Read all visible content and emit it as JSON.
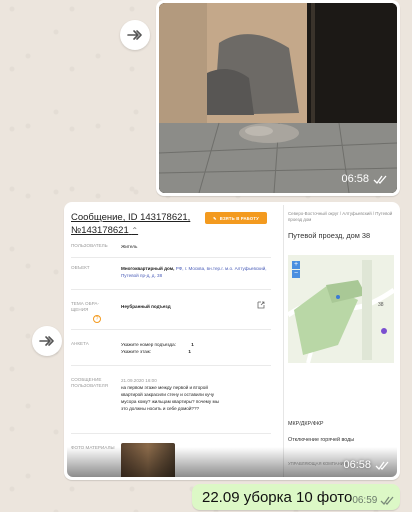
{
  "photo_message": {
    "time": "06:58"
  },
  "screenshot_message": {
    "time": "06:58",
    "title": "Сообщение, ID 143178621, №143178621",
    "take_button": "ВЗЯТЬ В РАБОТУ",
    "fields": [
      {
        "label": "ПОЛЬЗОВАТЕЛЬ",
        "value": "Житель"
      },
      {
        "label": "ОБЪЕКТ",
        "value_bold": "Многоквартирный дом, ",
        "value_link": "РФ, г. Москва, вн.тер.г. м.о. Алтуфьевский, Путевой пр-д, д. 38"
      },
      {
        "label": "ТЕМА ОБРА-ЩЕНИЯ",
        "value": "Неубранный подъезд"
      },
      {
        "label": "АНКЕТА",
        "line1_label": "Укажите номер подъезда:",
        "line1_value": "1",
        "line2_label": "Укажите этаж:",
        "line2_value": "1"
      },
      {
        "label": "СООБЩЕНИЕ ПОЛЬЗОВАТЕЛЯ",
        "date": "21.09.2020 16:00",
        "value": "на первом этаже между первой и второй квартирой закрасили стену и оставили кучу мусора кому? жильцам квартиры? почему мы это должны носить и себе домой???"
      },
      {
        "label": "ФОТО МАТЕРИАЛЫ"
      }
    ],
    "right": {
      "breadcrumb": "Северо-Восточный округ / Алтуфьевский / Путевой проезд дом",
      "address": "Путевой проезд, дом 38",
      "map_zoom_in": "+",
      "map_zoom_out": "−",
      "map_label": "38",
      "type": "МКР/ДКР/ФКР",
      "status": "Отключение горячей воды",
      "footer_label": "УПРАВЛЯЮЩАЯ КОМПАНИЯ"
    }
  },
  "text_message": {
    "text": "22.09 уборка 10 фото",
    "time": "06:59"
  }
}
